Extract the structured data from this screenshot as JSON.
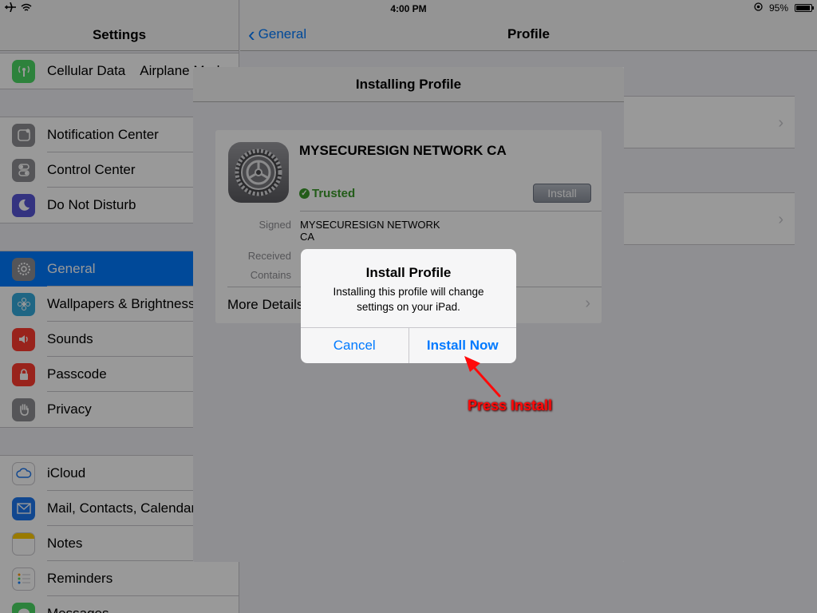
{
  "status_bar": {
    "time": "4:00 PM",
    "battery": "95%",
    "battery_level": 0.95
  },
  "sidebar": {
    "title": "Settings",
    "groups": [
      [
        {
          "label": "Cellular Data",
          "extra": "Airplane Mode",
          "icon": "antenna-icon",
          "color": "#4cd964"
        }
      ],
      [
        {
          "label": "Notification Center",
          "icon": "notification-icon",
          "color": "#8e8e93"
        },
        {
          "label": "Control Center",
          "icon": "toggles-icon",
          "color": "#8e8e93"
        },
        {
          "label": "Do Not Disturb",
          "icon": "moon-icon",
          "color": "#5856d6"
        }
      ],
      [
        {
          "label": "General",
          "icon": "gear-icon",
          "color": "#8e8e93",
          "selected": true
        },
        {
          "label": "Wallpapers & Brightness",
          "icon": "flower-icon",
          "color": "#34aadc"
        },
        {
          "label": "Sounds",
          "icon": "speaker-icon",
          "color": "#ff3b30"
        },
        {
          "label": "Passcode",
          "icon": "lock-icon",
          "color": "#ff3b30"
        },
        {
          "label": "Privacy",
          "icon": "hand-icon",
          "color": "#8e8e93"
        }
      ],
      [
        {
          "label": "iCloud",
          "icon": "cloud-icon",
          "color": "#ffffff"
        },
        {
          "label": "Mail, Contacts, Calendars",
          "icon": "mail-icon",
          "color": "#1d77ef"
        },
        {
          "label": "Notes",
          "icon": "notes-icon",
          "color": "#ffcc00"
        },
        {
          "label": "Reminders",
          "icon": "reminders-icon",
          "color": "#ffffff"
        },
        {
          "label": "Messages",
          "icon": "messages-icon",
          "color": "#4cd964"
        }
      ]
    ]
  },
  "detail": {
    "back_label": "General",
    "title": "Profile"
  },
  "sheet": {
    "title": "Installing Profile",
    "profile_name": "MYSECURESIGN NETWORK CA",
    "trusted_label": "Trusted",
    "install_label": "Install",
    "signed_key": "Signed",
    "signed_value_line1": "MYSECURESIGN NETWORK",
    "signed_value_line2": "CA",
    "received_key": "Received",
    "contains_key": "Contains",
    "more_details": "More Details"
  },
  "alert": {
    "title": "Install Profile",
    "message": "Installing this profile will change settings on your iPad.",
    "cancel_label": "Cancel",
    "confirm_label": "Install Now"
  },
  "annotation": {
    "text": "Press Install",
    "color": "#ff0a0a"
  },
  "colors": {
    "accent": "#007aff",
    "trusted": "#3b9a2a"
  }
}
